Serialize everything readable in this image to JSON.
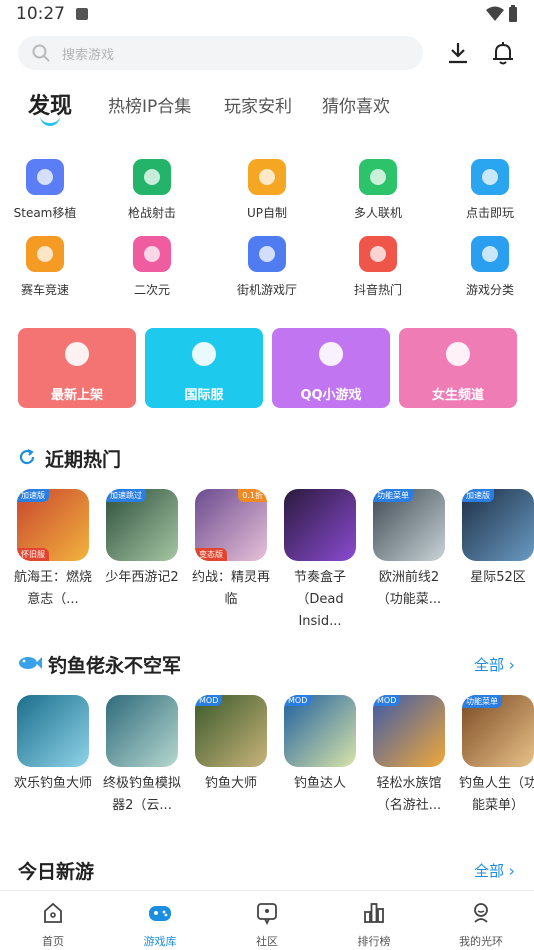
{
  "status_bar": {
    "time": "10:27"
  },
  "search": {
    "placeholder": "搜索游戏"
  },
  "tabs": [
    {
      "label": "发现"
    },
    {
      "label": "热榜IP合集"
    },
    {
      "label": "玩家安利"
    },
    {
      "label": "猜你喜欢"
    }
  ],
  "categories": [
    {
      "label": "Steam移植",
      "icon": "steam-port-icon",
      "color": "#5b7df5"
    },
    {
      "label": "枪战射击",
      "icon": "radar-icon",
      "color": "#23b46a"
    },
    {
      "label": "UP自制",
      "icon": "star-badge-icon",
      "color": "#f5a623"
    },
    {
      "label": "多人联机",
      "icon": "gamepad-icon",
      "color": "#2cc36b"
    },
    {
      "label": "点击即玩",
      "icon": "lightning-play-icon",
      "color": "#2aa5f0"
    },
    {
      "label": "赛车竞速",
      "icon": "car-icon",
      "color": "#f59a23"
    },
    {
      "label": "二次元",
      "icon": "cat-face-icon",
      "color": "#f05ca0"
    },
    {
      "label": "街机游戏厅",
      "icon": "arcade-icon",
      "color": "#4f7cf0"
    },
    {
      "label": "抖音热门",
      "icon": "flame-icon",
      "color": "#f0554a"
    },
    {
      "label": "游戏分类",
      "icon": "category-grid-icon",
      "color": "#2a9ff0"
    }
  ],
  "cards": [
    {
      "label": "最新上架",
      "color": "#f47474",
      "icon": "flame-icon"
    },
    {
      "label": "国际服",
      "color": "#1ec9ee",
      "icon": "helmet-icon"
    },
    {
      "label": "QQ小游戏",
      "color": "#c175f0",
      "icon": "pacman-icon"
    },
    {
      "label": "女生频道",
      "color": "#f07cb5",
      "icon": "bow-icon"
    }
  ],
  "hot_section": {
    "title": "近期热门"
  },
  "hot_games": [
    {
      "name": "航海王：燃烧意志（...",
      "badge_tl": "加速版",
      "badge_bl": "怀旧服",
      "colors": [
        "#c8462f",
        "#f2b33d"
      ]
    },
    {
      "name": "少年西游记2",
      "badge_tl": "加速跳过",
      "colors": [
        "#2d4f3b",
        "#a6c7a4"
      ]
    },
    {
      "name": "约战：精灵再临",
      "badge_tr": "0.1折",
      "badge_bl": "变态版",
      "colors": [
        "#6a4b8f",
        "#e8c1d8"
      ]
    },
    {
      "name": "节奏盒子（Dead Insid...",
      "colors": [
        "#2b1a3d",
        "#8a4bd1"
      ]
    },
    {
      "name": "欧洲前线2（功能菜...",
      "badge_tl": "功能菜单",
      "colors": [
        "#3e4a52",
        "#c9d3d8"
      ]
    },
    {
      "name": "星际52区",
      "badge_tl": "加速版",
      "colors": [
        "#1d2f46",
        "#6a9ac2"
      ]
    }
  ],
  "fishing_section": {
    "title": "钓鱼佬永不空军",
    "more": "全部"
  },
  "fishing_games": [
    {
      "name": "欢乐钓鱼大师",
      "colors": [
        "#1b6e8c",
        "#8fd3e8"
      ]
    },
    {
      "name": "终极钓鱼模拟器2（云...",
      "colors": [
        "#2f6a7a",
        "#b6d8d0"
      ]
    },
    {
      "name": "钓鱼大师",
      "badge_tl": "MOD",
      "colors": [
        "#3a5a2a",
        "#c8b37a"
      ]
    },
    {
      "name": "钓鱼达人",
      "badge_tl": "MOD",
      "colors": [
        "#1f5fa0",
        "#d9e4a8"
      ]
    },
    {
      "name": "轻松水族馆（名游社...",
      "badge_tl": "MOD",
      "colors": [
        "#3d5aa8",
        "#f0a83a"
      ]
    },
    {
      "name": "钓鱼人生（功能菜单）",
      "badge_tl": "功能菜单",
      "colors": [
        "#7b4a24",
        "#e8c188"
      ]
    }
  ],
  "new_section": {
    "title": "今日新游",
    "more": "全部"
  },
  "navbar": [
    {
      "label": "首页",
      "icon": "home-icon"
    },
    {
      "label": "游戏库",
      "icon": "game-library-icon",
      "active": true
    },
    {
      "label": "社区",
      "icon": "community-icon"
    },
    {
      "label": "排行榜",
      "icon": "ranking-icon"
    },
    {
      "label": "我的光环",
      "icon": "profile-icon"
    }
  ]
}
